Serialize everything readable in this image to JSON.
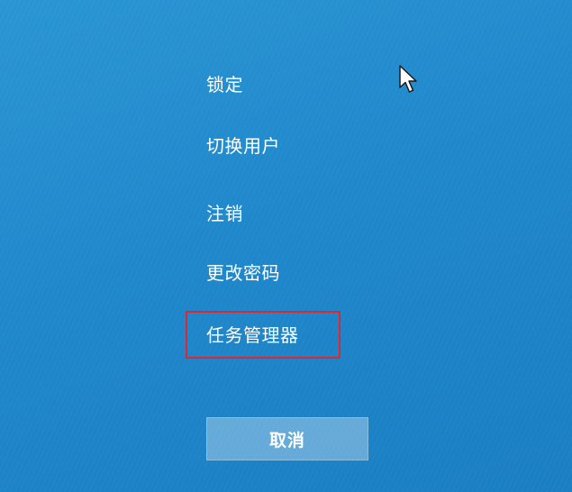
{
  "menu": {
    "items": [
      {
        "label": "锁定"
      },
      {
        "label": "切换用户"
      },
      {
        "label": "注销"
      },
      {
        "label": "更改密码"
      },
      {
        "label": "任务管理器"
      }
    ],
    "highlighted_item": "任务管理器"
  },
  "cancel_button": {
    "label": "取消"
  },
  "colors": {
    "background": "#1f88cb",
    "text": "#ffffff",
    "highlight_border": "#e0262e"
  },
  "icons": {
    "cursor": "mouse-pointer-icon"
  }
}
